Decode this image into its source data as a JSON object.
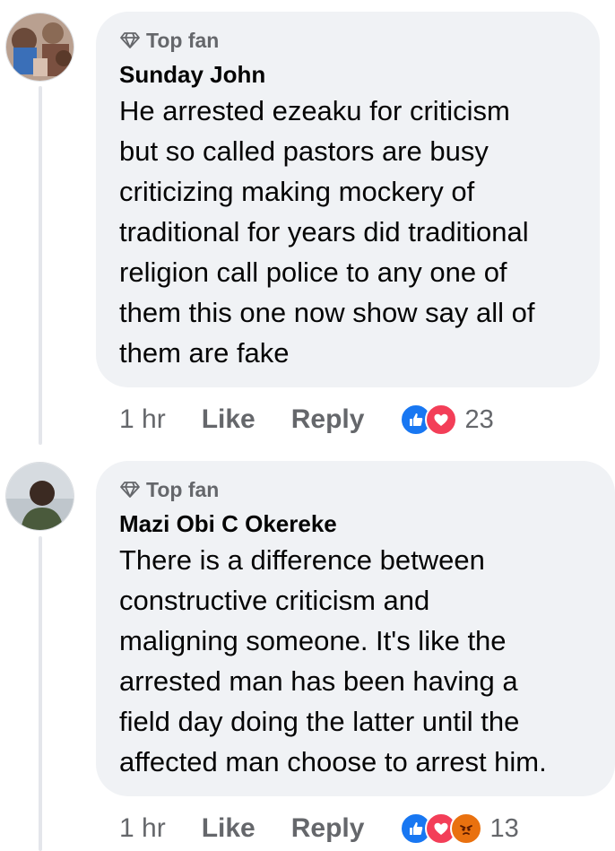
{
  "comments": [
    {
      "badge": "Top fan",
      "author": "Sunday John",
      "text": "He arrested ezeaku for criticism\nbut so called pastors are busy\ncriticizing making mockery of\ntraditional for years did traditional\nreligion call police to any one of\nthem this one now show say all of\nthem are fake",
      "time": "1 hr",
      "like_label": "Like",
      "reply_label": "Reply",
      "reactions": [
        "like-icon",
        "love-icon"
      ],
      "reaction_count": "23"
    },
    {
      "badge": "Top fan",
      "author": "Mazi Obi C Okereke",
      "text": "There is a difference between\nconstructive criticism and\nmaligning someone. It's like the\narrested man has been having a\nfield day doing the latter until the\naffected man choose to arrest him.",
      "time": "1 hr",
      "like_label": "Like",
      "reply_label": "Reply",
      "reactions": [
        "like-icon",
        "love-icon",
        "angry-icon"
      ],
      "reaction_count": "13"
    }
  ],
  "colors": {
    "bubble": "#f0f2f5",
    "secondary_text": "#65676b",
    "like_blue": "#1877f2",
    "love_red": "#f33e58",
    "angry_orange": "#e9710f"
  }
}
